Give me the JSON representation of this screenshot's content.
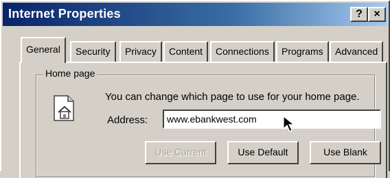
{
  "window": {
    "title": "Internet Properties"
  },
  "titlebar": {
    "help_glyph": "?",
    "close_glyph": "×"
  },
  "tabs": [
    {
      "label": "General",
      "active": true
    },
    {
      "label": "Security"
    },
    {
      "label": "Privacy"
    },
    {
      "label": "Content"
    },
    {
      "label": "Connections"
    },
    {
      "label": "Programs"
    },
    {
      "label": "Advanced"
    }
  ],
  "home_page": {
    "legend": "Home page",
    "description": "You can change which page to use for your home page.",
    "address_label": "Address:",
    "address_value": "www.ebankwest.com",
    "buttons": {
      "use_current": "Use Current",
      "use_default": "Use Default",
      "use_blank": "Use Blank"
    }
  },
  "icons": [
    "home-page-icon",
    "mouse-pointer-icon",
    "help-icon",
    "close-icon"
  ]
}
